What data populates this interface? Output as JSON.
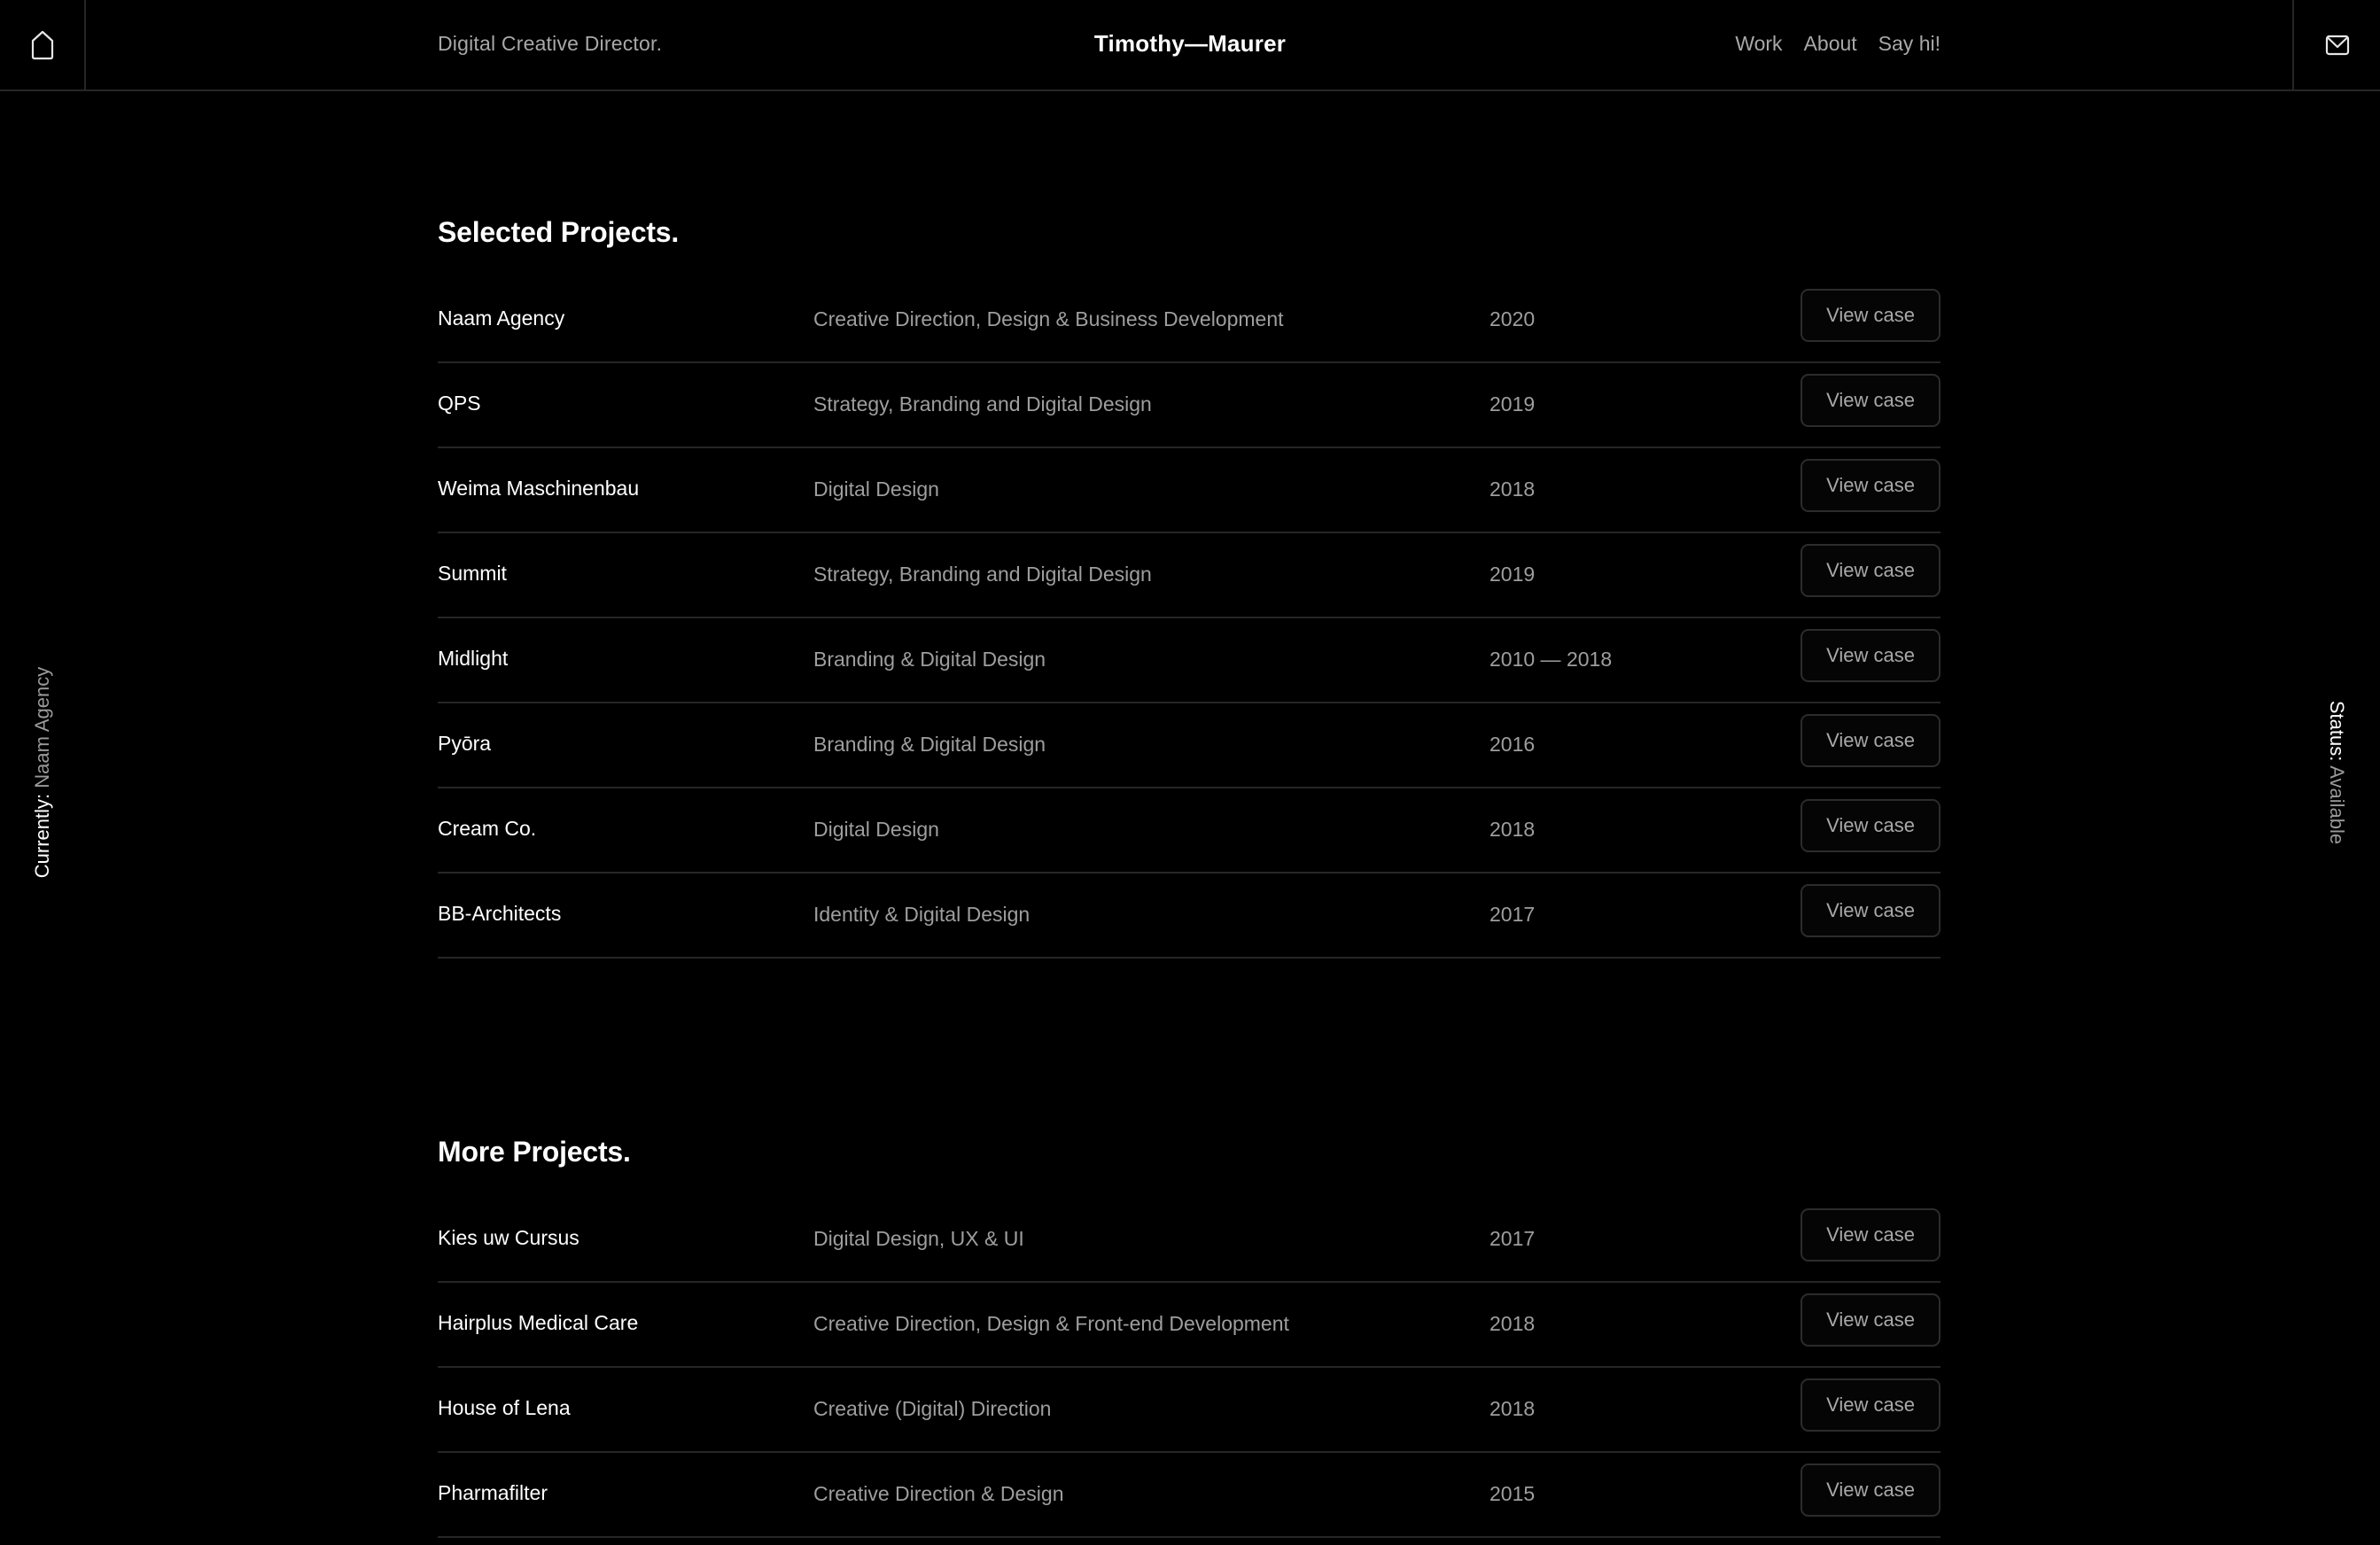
{
  "header": {
    "tagline": "Digital Creative Director.",
    "brand": "Timothy—Maurer",
    "nav": [
      {
        "label": "Work"
      },
      {
        "label": "About"
      },
      {
        "label": "Say hi!"
      }
    ],
    "home_icon": "home-icon",
    "mail_icon": "mail-icon"
  },
  "side_left": {
    "label": "Currently:",
    "value": "Naam Agency"
  },
  "side_right": {
    "label": "Status:",
    "value": "Available"
  },
  "selected": {
    "title": "Selected Projects.",
    "rows": [
      {
        "name": "Naam Agency",
        "discipline": "Creative Direction, Design & Business Development",
        "year": "2020",
        "button": "View case"
      },
      {
        "name": "QPS",
        "discipline": "Strategy, Branding and Digital Design",
        "year": "2019",
        "button": "View case"
      },
      {
        "name": "Weima Maschinenbau",
        "discipline": "Digital Design",
        "year": "2018",
        "button": "View case"
      },
      {
        "name": "Summit",
        "discipline": "Strategy, Branding and Digital Design",
        "year": "2019",
        "button": "View case"
      },
      {
        "name": "Midlight",
        "discipline": "Branding & Digital Design",
        "year": "2010 — 2018",
        "button": "View case"
      },
      {
        "name": "Pyōra",
        "discipline": "Branding & Digital Design",
        "year": "2016",
        "button": "View case"
      },
      {
        "name": "Cream Co.",
        "discipline": "Digital Design",
        "year": "2018",
        "button": "View case"
      },
      {
        "name": "BB-Architects",
        "discipline": "Identity & Digital Design",
        "year": "2017",
        "button": "View case"
      }
    ]
  },
  "more": {
    "title": "More Projects.",
    "rows": [
      {
        "name": "Kies uw Cursus",
        "discipline": "Digital Design, UX & UI",
        "year": "2017",
        "button": "View case"
      },
      {
        "name": "Hairplus Medical Care",
        "discipline": "Creative Direction, Design & Front-end Development",
        "year": "2018",
        "button": "View case"
      },
      {
        "name": "House of Lena",
        "discipline": "Creative (Digital) Direction",
        "year": "2018",
        "button": "View case"
      },
      {
        "name": "Pharmafilter",
        "discipline": "Creative Direction & Design",
        "year": "2015",
        "button": "View case"
      }
    ]
  },
  "colors": {
    "background": "#000000",
    "primary_text": "#ffffff",
    "secondary_text": "#9e9e9e",
    "divider": "#262626",
    "button_border": "#2c2c2c"
  }
}
